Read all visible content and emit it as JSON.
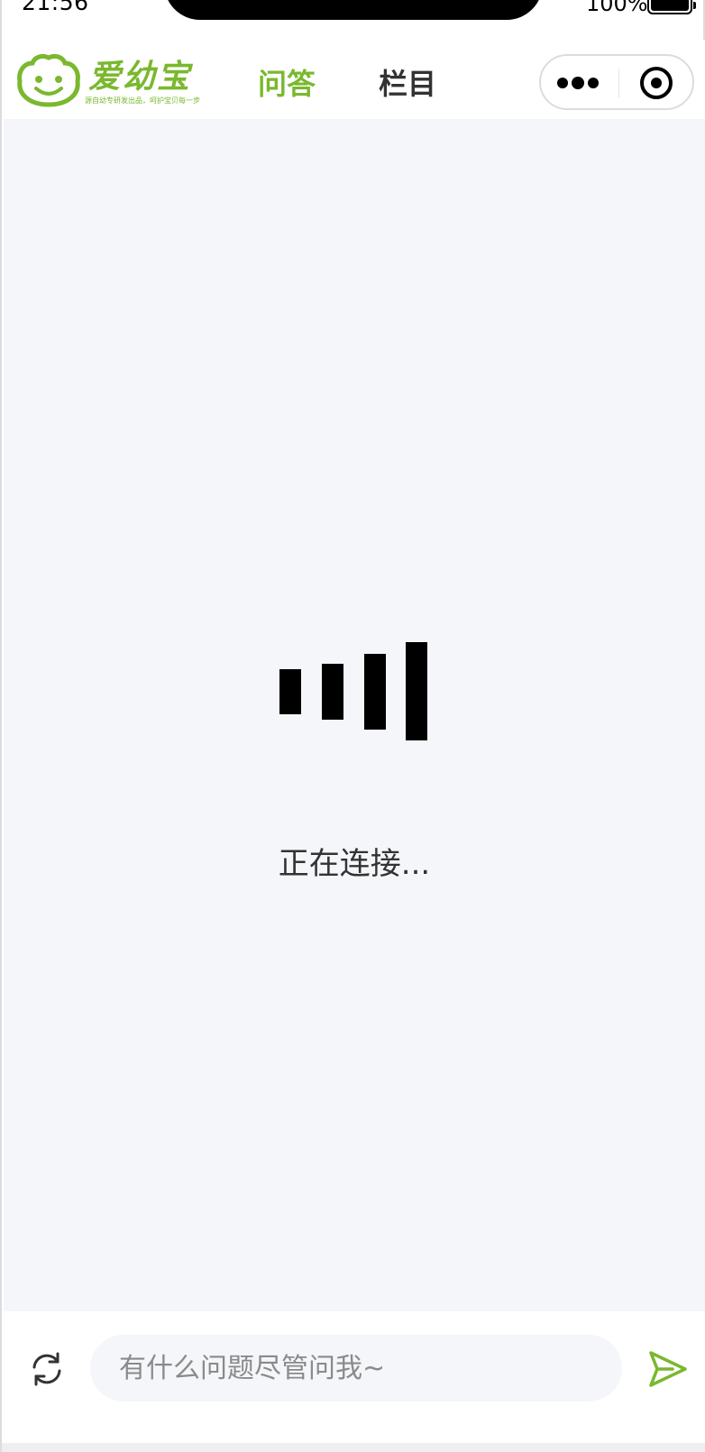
{
  "status_bar": {
    "time": "21:56",
    "battery_percent": "100%"
  },
  "header": {
    "logo": {
      "title": "爱幼宝",
      "slogan": "源自幼专研发出品，呵护宝贝每一步",
      "icon": "smiling-baby-face-logo"
    },
    "tabs": [
      {
        "label": "问答",
        "active": true
      },
      {
        "label": "栏目",
        "active": false
      }
    ],
    "capsule": {
      "more_icon": "more-dots-icon",
      "close_icon": "target-circle-icon"
    }
  },
  "main": {
    "loading_icon": "signal-bars-icon",
    "status_text": "正在连接..."
  },
  "input_bar": {
    "refresh_icon": "refresh-icon",
    "placeholder": "有什么问题尽管问我~",
    "value": "",
    "send_icon": "send-icon"
  },
  "colors": {
    "brand_green": "#7ab82e",
    "background": "#f5f6fa",
    "text_dark": "#333333"
  }
}
